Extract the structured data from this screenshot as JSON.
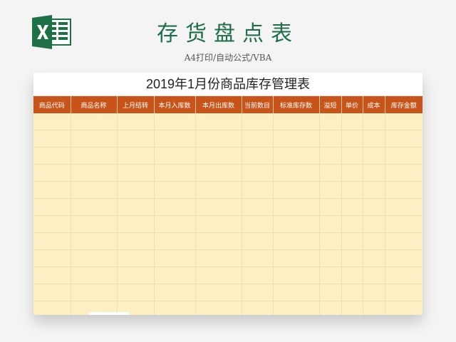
{
  "header": {
    "title": "存货盘点表",
    "subtitle": "A4打印/自动公式/VBA",
    "logo_icon": "excel-icon",
    "logo_color": "#1e7145"
  },
  "sheet": {
    "title": "2019年1月份商品库存管理表",
    "header_color": "#c8541a",
    "body_color": "#fdeec3",
    "columns": [
      {
        "label": "商品代码"
      },
      {
        "label": "商品名称"
      },
      {
        "label": "上月结转"
      },
      {
        "label": "本月入库数"
      },
      {
        "label": "本月出库数"
      },
      {
        "label": "当前数目"
      },
      {
        "label": "标准库存数"
      },
      {
        "label": "溢短"
      },
      {
        "label": "单价"
      },
      {
        "label": "成本"
      },
      {
        "label": "库存金额"
      }
    ],
    "empty_rows": 12
  }
}
